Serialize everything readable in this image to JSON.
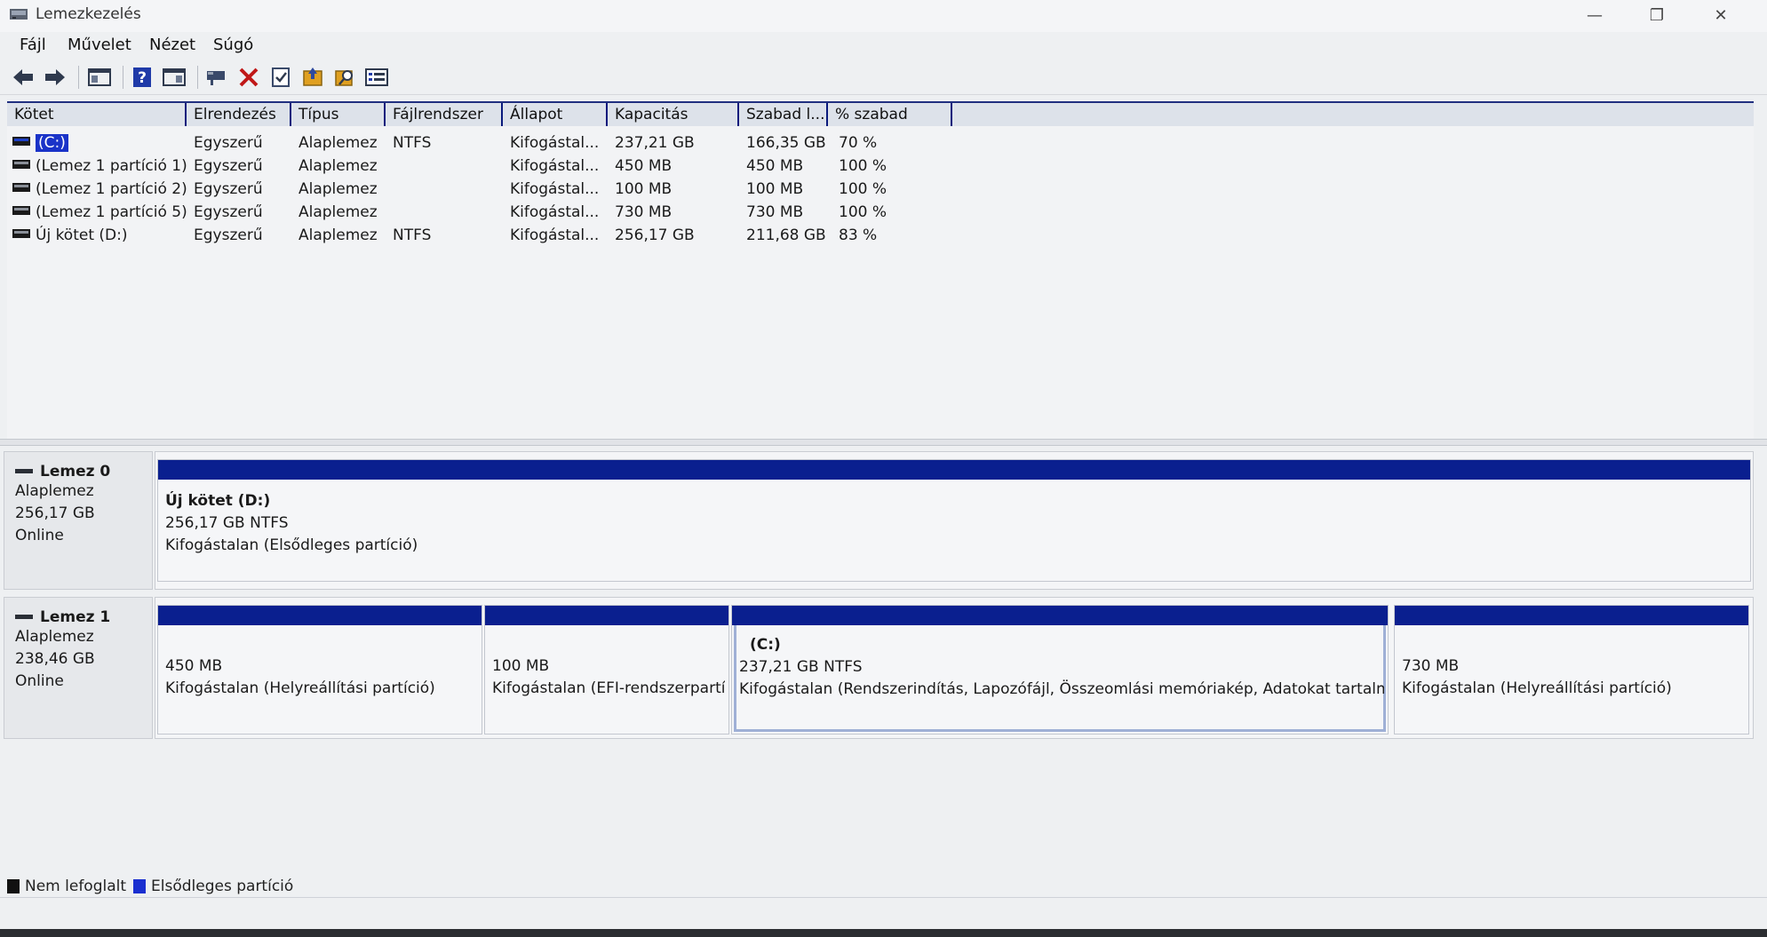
{
  "window": {
    "title": "Lemezkezelés",
    "minimize": "—",
    "restore": "❐",
    "close": "✕"
  },
  "menu": [
    "Fájl",
    "Művelet",
    "Nézet",
    "Súgó"
  ],
  "toolbar_icons": [
    "back-icon",
    "forward-icon",
    "console-tree-icon",
    "help-icon",
    "action-pane-icon",
    "connect-disk-icon",
    "delete-icon",
    "properties-icon",
    "export-icon",
    "search-icon",
    "list-view-icon"
  ],
  "columns": [
    "Kötet",
    "Elrendezés",
    "Típus",
    "Fájlrendszer",
    "Állapot",
    "Kapacitás",
    "Szabad l...",
    "% szabad"
  ],
  "volumes": [
    {
      "name": "(C:)",
      "layout": "Egyszerű",
      "type": "Alaplemez",
      "fs": "NTFS",
      "status": "Kifogástal...",
      "capacity": "237,21 GB",
      "free": "166,35 GB",
      "pct": "70 %"
    },
    {
      "name": "(Lemez 1 partíció 1)",
      "layout": "Egyszerű",
      "type": "Alaplemez",
      "fs": "",
      "status": "Kifogástal...",
      "capacity": "450 MB",
      "free": "450 MB",
      "pct": "100 %"
    },
    {
      "name": "(Lemez 1 partíció 2)",
      "layout": "Egyszerű",
      "type": "Alaplemez",
      "fs": "",
      "status": "Kifogástal...",
      "capacity": "100 MB",
      "free": "100 MB",
      "pct": "100 %"
    },
    {
      "name": "(Lemez 1 partíció 5)",
      "layout": "Egyszerű",
      "type": "Alaplemez",
      "fs": "",
      "status": "Kifogástal...",
      "capacity": "730 MB",
      "free": "730 MB",
      "pct": "100 %"
    },
    {
      "name": "Új kötet (D:)",
      "layout": "Egyszerű",
      "type": "Alaplemez",
      "fs": "NTFS",
      "status": "Kifogástal...",
      "capacity": "256,17 GB",
      "free": "211,68 GB",
      "pct": "83 %"
    }
  ],
  "disks": [
    {
      "name": "Lemez 0",
      "type": "Alaplemez",
      "size": "256,17 GB",
      "state": "Online",
      "partitions": [
        {
          "title": "Új kötet  (D:)",
          "line1": "256,17 GB NTFS",
          "line2": "Kifogástalan (Elsődleges partíció)"
        }
      ]
    },
    {
      "name": "Lemez 1",
      "type": "Alaplemez",
      "size": "238,46 GB",
      "state": "Online",
      "partitions": [
        {
          "title": "",
          "line1": "450 MB",
          "line2": "Kifogástalan (Helyreállítási partíció)"
        },
        {
          "title": "",
          "line1": "100 MB",
          "line2": "Kifogástalan (EFI-rendszerpartíció)"
        },
        {
          "title": "(C:)",
          "line1": "237,21 GB NTFS",
          "line2": "Kifogástalan (Rendszerindítás, Lapozófájl, Összeomlási memóriakép, Adatokat tartalmazó partíció)"
        },
        {
          "title": "",
          "line1": "730 MB",
          "line2": "Kifogástalan (Helyreállítási partíció)"
        }
      ]
    }
  ],
  "legend": [
    {
      "label": "Nem lefoglalt",
      "color": "#111111"
    },
    {
      "label": "Elsődleges partíció",
      "color": "#1a2fd0"
    }
  ],
  "colors": {
    "partition_bar": "#0a1f8f",
    "selection": "#1a33c8"
  }
}
